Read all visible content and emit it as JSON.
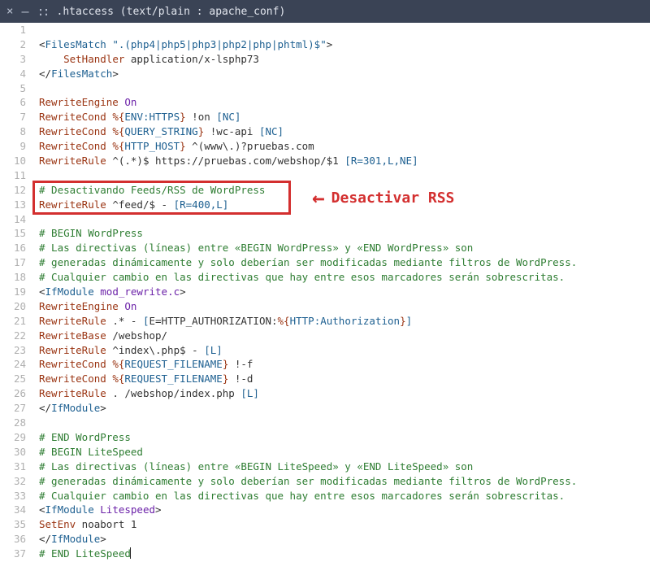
{
  "titlebar": {
    "close": "×",
    "dash": "–",
    "dots": "::",
    "title": ".htaccess (text/plain : apache_conf)"
  },
  "annotation": {
    "label": "Desactivar RSS"
  },
  "code": {
    "lines": [
      {
        "num": 1,
        "seg": []
      },
      {
        "num": 2,
        "seg": [
          [
            "t-punct",
            "<"
          ],
          [
            "t-tag",
            "FilesMatch"
          ],
          [
            "t-plain",
            " "
          ],
          [
            "t-str",
            "\".(php4|php5|php3|php2|php|phtml)$\""
          ],
          [
            "t-punct",
            ">"
          ]
        ]
      },
      {
        "num": 3,
        "seg": [
          [
            "t-plain",
            "    "
          ],
          [
            "t-dir",
            "SetHandler"
          ],
          [
            "t-plain",
            " application/x-lsphp73"
          ]
        ]
      },
      {
        "num": 4,
        "seg": [
          [
            "t-punct",
            "</"
          ],
          [
            "t-tag",
            "FilesMatch"
          ],
          [
            "t-punct",
            ">"
          ]
        ]
      },
      {
        "num": 5,
        "seg": []
      },
      {
        "num": 6,
        "seg": [
          [
            "t-dir",
            "RewriteEngine"
          ],
          [
            "t-plain",
            " "
          ],
          [
            "t-arg",
            "On"
          ]
        ]
      },
      {
        "num": 7,
        "seg": [
          [
            "t-dir",
            "RewriteCond"
          ],
          [
            "t-plain",
            " "
          ],
          [
            "t-varbrace",
            "%{"
          ],
          [
            "t-varname",
            "ENV:HTTPS"
          ],
          [
            "t-varbrace",
            "}"
          ],
          [
            "t-plain",
            " !on "
          ],
          [
            "t-flag",
            "[NC]"
          ]
        ]
      },
      {
        "num": 8,
        "seg": [
          [
            "t-dir",
            "RewriteCond"
          ],
          [
            "t-plain",
            " "
          ],
          [
            "t-varbrace",
            "%{"
          ],
          [
            "t-varname",
            "QUERY_STRING"
          ],
          [
            "t-varbrace",
            "}"
          ],
          [
            "t-plain",
            " !wc-api "
          ],
          [
            "t-flag",
            "[NC]"
          ]
        ]
      },
      {
        "num": 9,
        "seg": [
          [
            "t-dir",
            "RewriteCond"
          ],
          [
            "t-plain",
            " "
          ],
          [
            "t-varbrace",
            "%{"
          ],
          [
            "t-varname",
            "HTTP_HOST"
          ],
          [
            "t-varbrace",
            "}"
          ],
          [
            "t-plain",
            " ^(www\\.)?pruebas.com"
          ]
        ]
      },
      {
        "num": 10,
        "seg": [
          [
            "t-dir",
            "RewriteRule"
          ],
          [
            "t-plain",
            " ^(.*)$ https://pruebas.com/webshop/$1 "
          ],
          [
            "t-flag",
            "[R=301,L,NE]"
          ]
        ]
      },
      {
        "num": 11,
        "seg": []
      },
      {
        "num": 12,
        "seg": [
          [
            "t-comment",
            "# Desactivando Feeds/RSS de WordPress"
          ]
        ]
      },
      {
        "num": 13,
        "seg": [
          [
            "t-dir",
            "RewriteRule"
          ],
          [
            "t-plain",
            " ^feed/$ - "
          ],
          [
            "t-flag",
            "[R=400,L]"
          ]
        ]
      },
      {
        "num": 14,
        "seg": []
      },
      {
        "num": 15,
        "seg": [
          [
            "t-comment",
            "# BEGIN WordPress"
          ]
        ]
      },
      {
        "num": 16,
        "seg": [
          [
            "t-comment",
            "# Las directivas (líneas) entre «BEGIN WordPress» y «END WordPress» son"
          ]
        ]
      },
      {
        "num": 17,
        "seg": [
          [
            "t-comment",
            "# generadas dinámicamente y solo deberían ser modificadas mediante filtros de WordPress."
          ]
        ]
      },
      {
        "num": 18,
        "seg": [
          [
            "t-comment",
            "# Cualquier cambio en las directivas que hay entre esos marcadores serán sobrescritas."
          ]
        ]
      },
      {
        "num": 19,
        "seg": [
          [
            "t-punct",
            "<"
          ],
          [
            "t-tag",
            "IfModule"
          ],
          [
            "t-plain",
            " "
          ],
          [
            "t-arg",
            "mod_rewrite.c"
          ],
          [
            "t-punct",
            ">"
          ]
        ]
      },
      {
        "num": 20,
        "seg": [
          [
            "t-dir",
            "RewriteEngine"
          ],
          [
            "t-plain",
            " "
          ],
          [
            "t-arg",
            "On"
          ]
        ]
      },
      {
        "num": 21,
        "seg": [
          [
            "t-dir",
            "RewriteRule"
          ],
          [
            "t-plain",
            " .* - "
          ],
          [
            "t-flag",
            "["
          ],
          [
            "t-plain",
            "E=HTTP_AUTHORIZATION:"
          ],
          [
            "t-varbrace",
            "%{"
          ],
          [
            "t-varname",
            "HTTP:Authorization"
          ],
          [
            "t-varbrace",
            "}"
          ],
          [
            "t-flag",
            "]"
          ]
        ]
      },
      {
        "num": 22,
        "seg": [
          [
            "t-dir",
            "RewriteBase"
          ],
          [
            "t-plain",
            " /webshop/"
          ]
        ]
      },
      {
        "num": 23,
        "seg": [
          [
            "t-dir",
            "RewriteRule"
          ],
          [
            "t-plain",
            " ^index\\.php$ - "
          ],
          [
            "t-flag",
            "[L]"
          ]
        ]
      },
      {
        "num": 24,
        "seg": [
          [
            "t-dir",
            "RewriteCond"
          ],
          [
            "t-plain",
            " "
          ],
          [
            "t-varbrace",
            "%{"
          ],
          [
            "t-varname",
            "REQUEST_FILENAME"
          ],
          [
            "t-varbrace",
            "}"
          ],
          [
            "t-plain",
            " !-f"
          ]
        ]
      },
      {
        "num": 25,
        "seg": [
          [
            "t-dir",
            "RewriteCond"
          ],
          [
            "t-plain",
            " "
          ],
          [
            "t-varbrace",
            "%{"
          ],
          [
            "t-varname",
            "REQUEST_FILENAME"
          ],
          [
            "t-varbrace",
            "}"
          ],
          [
            "t-plain",
            " !-d"
          ]
        ]
      },
      {
        "num": 26,
        "seg": [
          [
            "t-dir",
            "RewriteRule"
          ],
          [
            "t-plain",
            " . /webshop/index.php "
          ],
          [
            "t-flag",
            "[L]"
          ]
        ]
      },
      {
        "num": 27,
        "seg": [
          [
            "t-punct",
            "</"
          ],
          [
            "t-tag",
            "IfModule"
          ],
          [
            "t-punct",
            ">"
          ]
        ]
      },
      {
        "num": 28,
        "seg": []
      },
      {
        "num": 29,
        "seg": [
          [
            "t-comment",
            "# END WordPress"
          ]
        ]
      },
      {
        "num": 30,
        "seg": [
          [
            "t-comment",
            "# BEGIN LiteSpeed"
          ]
        ]
      },
      {
        "num": 31,
        "seg": [
          [
            "t-comment",
            "# Las directivas (líneas) entre «BEGIN LiteSpeed» y «END LiteSpeed» son"
          ]
        ]
      },
      {
        "num": 32,
        "seg": [
          [
            "t-comment",
            "# generadas dinámicamente y solo deberían ser modificadas mediante filtros de WordPress."
          ]
        ]
      },
      {
        "num": 33,
        "seg": [
          [
            "t-comment",
            "# Cualquier cambio en las directivas que hay entre esos marcadores serán sobrescritas."
          ]
        ]
      },
      {
        "num": 34,
        "seg": [
          [
            "t-punct",
            "<"
          ],
          [
            "t-tag",
            "IfModule"
          ],
          [
            "t-plain",
            " "
          ],
          [
            "t-arg",
            "Litespeed"
          ],
          [
            "t-punct",
            ">"
          ]
        ]
      },
      {
        "num": 35,
        "seg": [
          [
            "t-dir",
            "SetEnv"
          ],
          [
            "t-plain",
            " noabort 1"
          ]
        ]
      },
      {
        "num": 36,
        "seg": [
          [
            "t-punct",
            "</"
          ],
          [
            "t-tag",
            "IfModule"
          ],
          [
            "t-punct",
            ">"
          ]
        ]
      },
      {
        "num": 37,
        "seg": [
          [
            "t-comment",
            "# END LiteSpeed"
          ]
        ],
        "caret": true
      }
    ]
  },
  "highlight": {
    "startLine": 12,
    "endLine": 13
  }
}
